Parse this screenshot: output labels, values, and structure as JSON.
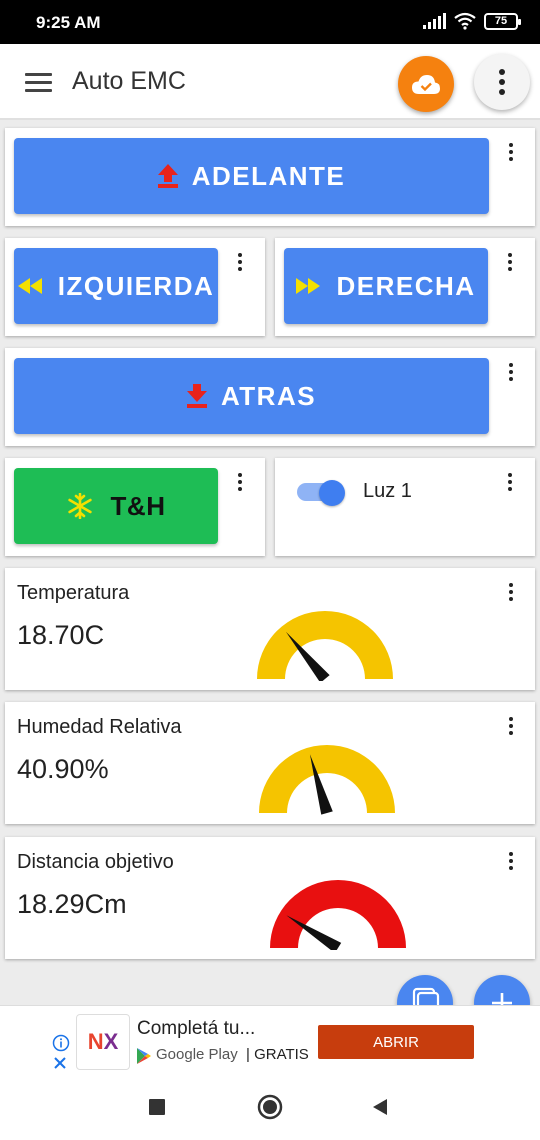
{
  "status_bar": {
    "time": "9:25 AM",
    "battery": "75"
  },
  "app_bar": {
    "title": "Auto EMC"
  },
  "buttons": {
    "adelante": "ADELANTE",
    "izquierda": "IZQUIERDA",
    "derecha": "DERECHA",
    "atras": "ATRAS",
    "th": "T&H"
  },
  "switch": {
    "label": "Luz 1",
    "on": true
  },
  "gauges": [
    {
      "title": "Temperatura",
      "value": "18.70C",
      "color": "#f5c400",
      "needle_fraction": 0.28
    },
    {
      "title": "Humedad Relativa",
      "value": "40.90%",
      "color": "#f5c400",
      "needle_fraction": 0.41
    },
    {
      "title": "Distancia objetivo",
      "value": "18.29Cm",
      "color": "#e81010",
      "needle_fraction": 0.18
    }
  ],
  "ad": {
    "logo": "NX",
    "title": "Completá tu...",
    "store": "Google Play",
    "price": "| GRATIS",
    "cta": "ABRIR"
  },
  "colors": {
    "accent": "#4a86f0",
    "cloud": "#f5810f",
    "green": "#1ebd55",
    "arrow_red": "#e8231c",
    "arrow_yellow": "#f4e000"
  }
}
